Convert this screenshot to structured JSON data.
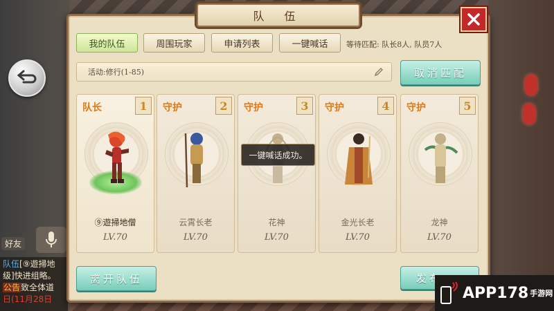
{
  "panel": {
    "title": "队 伍",
    "tabs": [
      {
        "label": "我的队伍",
        "active": true
      },
      {
        "label": "周围玩家",
        "active": false
      },
      {
        "label": "申请列表",
        "active": false
      },
      {
        "label": "一键喊话",
        "active": false
      }
    ],
    "team_info": "等待匹配: 队长8人, 队员7人",
    "activity": "活动:修行(1-85)",
    "cancel_match_label": "取消匹配",
    "leave_team_label": "离开队伍",
    "right_button_label": "发布"
  },
  "members": [
    {
      "role": "队长",
      "slot": "1",
      "name": "⑨遊掃地僧",
      "level": "LV.70",
      "leader": true
    },
    {
      "role": "守护",
      "slot": "2",
      "name": "云霄长老",
      "level": "LV.70",
      "leader": false
    },
    {
      "role": "守护",
      "slot": "3",
      "name": "花神",
      "level": "LV.70",
      "leader": false
    },
    {
      "role": "守护",
      "slot": "4",
      "name": "金光长老",
      "level": "LV.70",
      "leader": false
    },
    {
      "role": "守护",
      "slot": "5",
      "name": "龙神",
      "level": "LV.70",
      "leader": false
    }
  ],
  "toast": "一键喊话成功。",
  "side": {
    "friend_label": "好友",
    "chat": [
      {
        "tag": "队伍",
        "text": "[⑨遊掃地"
      },
      {
        "tag": "",
        "text": "级]快进组略。"
      },
      {
        "tag": "公告",
        "text": "致全体道"
      },
      {
        "tag": "",
        "text": "日(11月28日"
      }
    ]
  },
  "watermark": {
    "text": "APP178",
    "sub": "手游网"
  },
  "colors": {
    "accent_teal": "#78cdbb",
    "role_orange": "#e07816",
    "close_red": "#c4272a",
    "leader_glow": "#6fc45c"
  }
}
